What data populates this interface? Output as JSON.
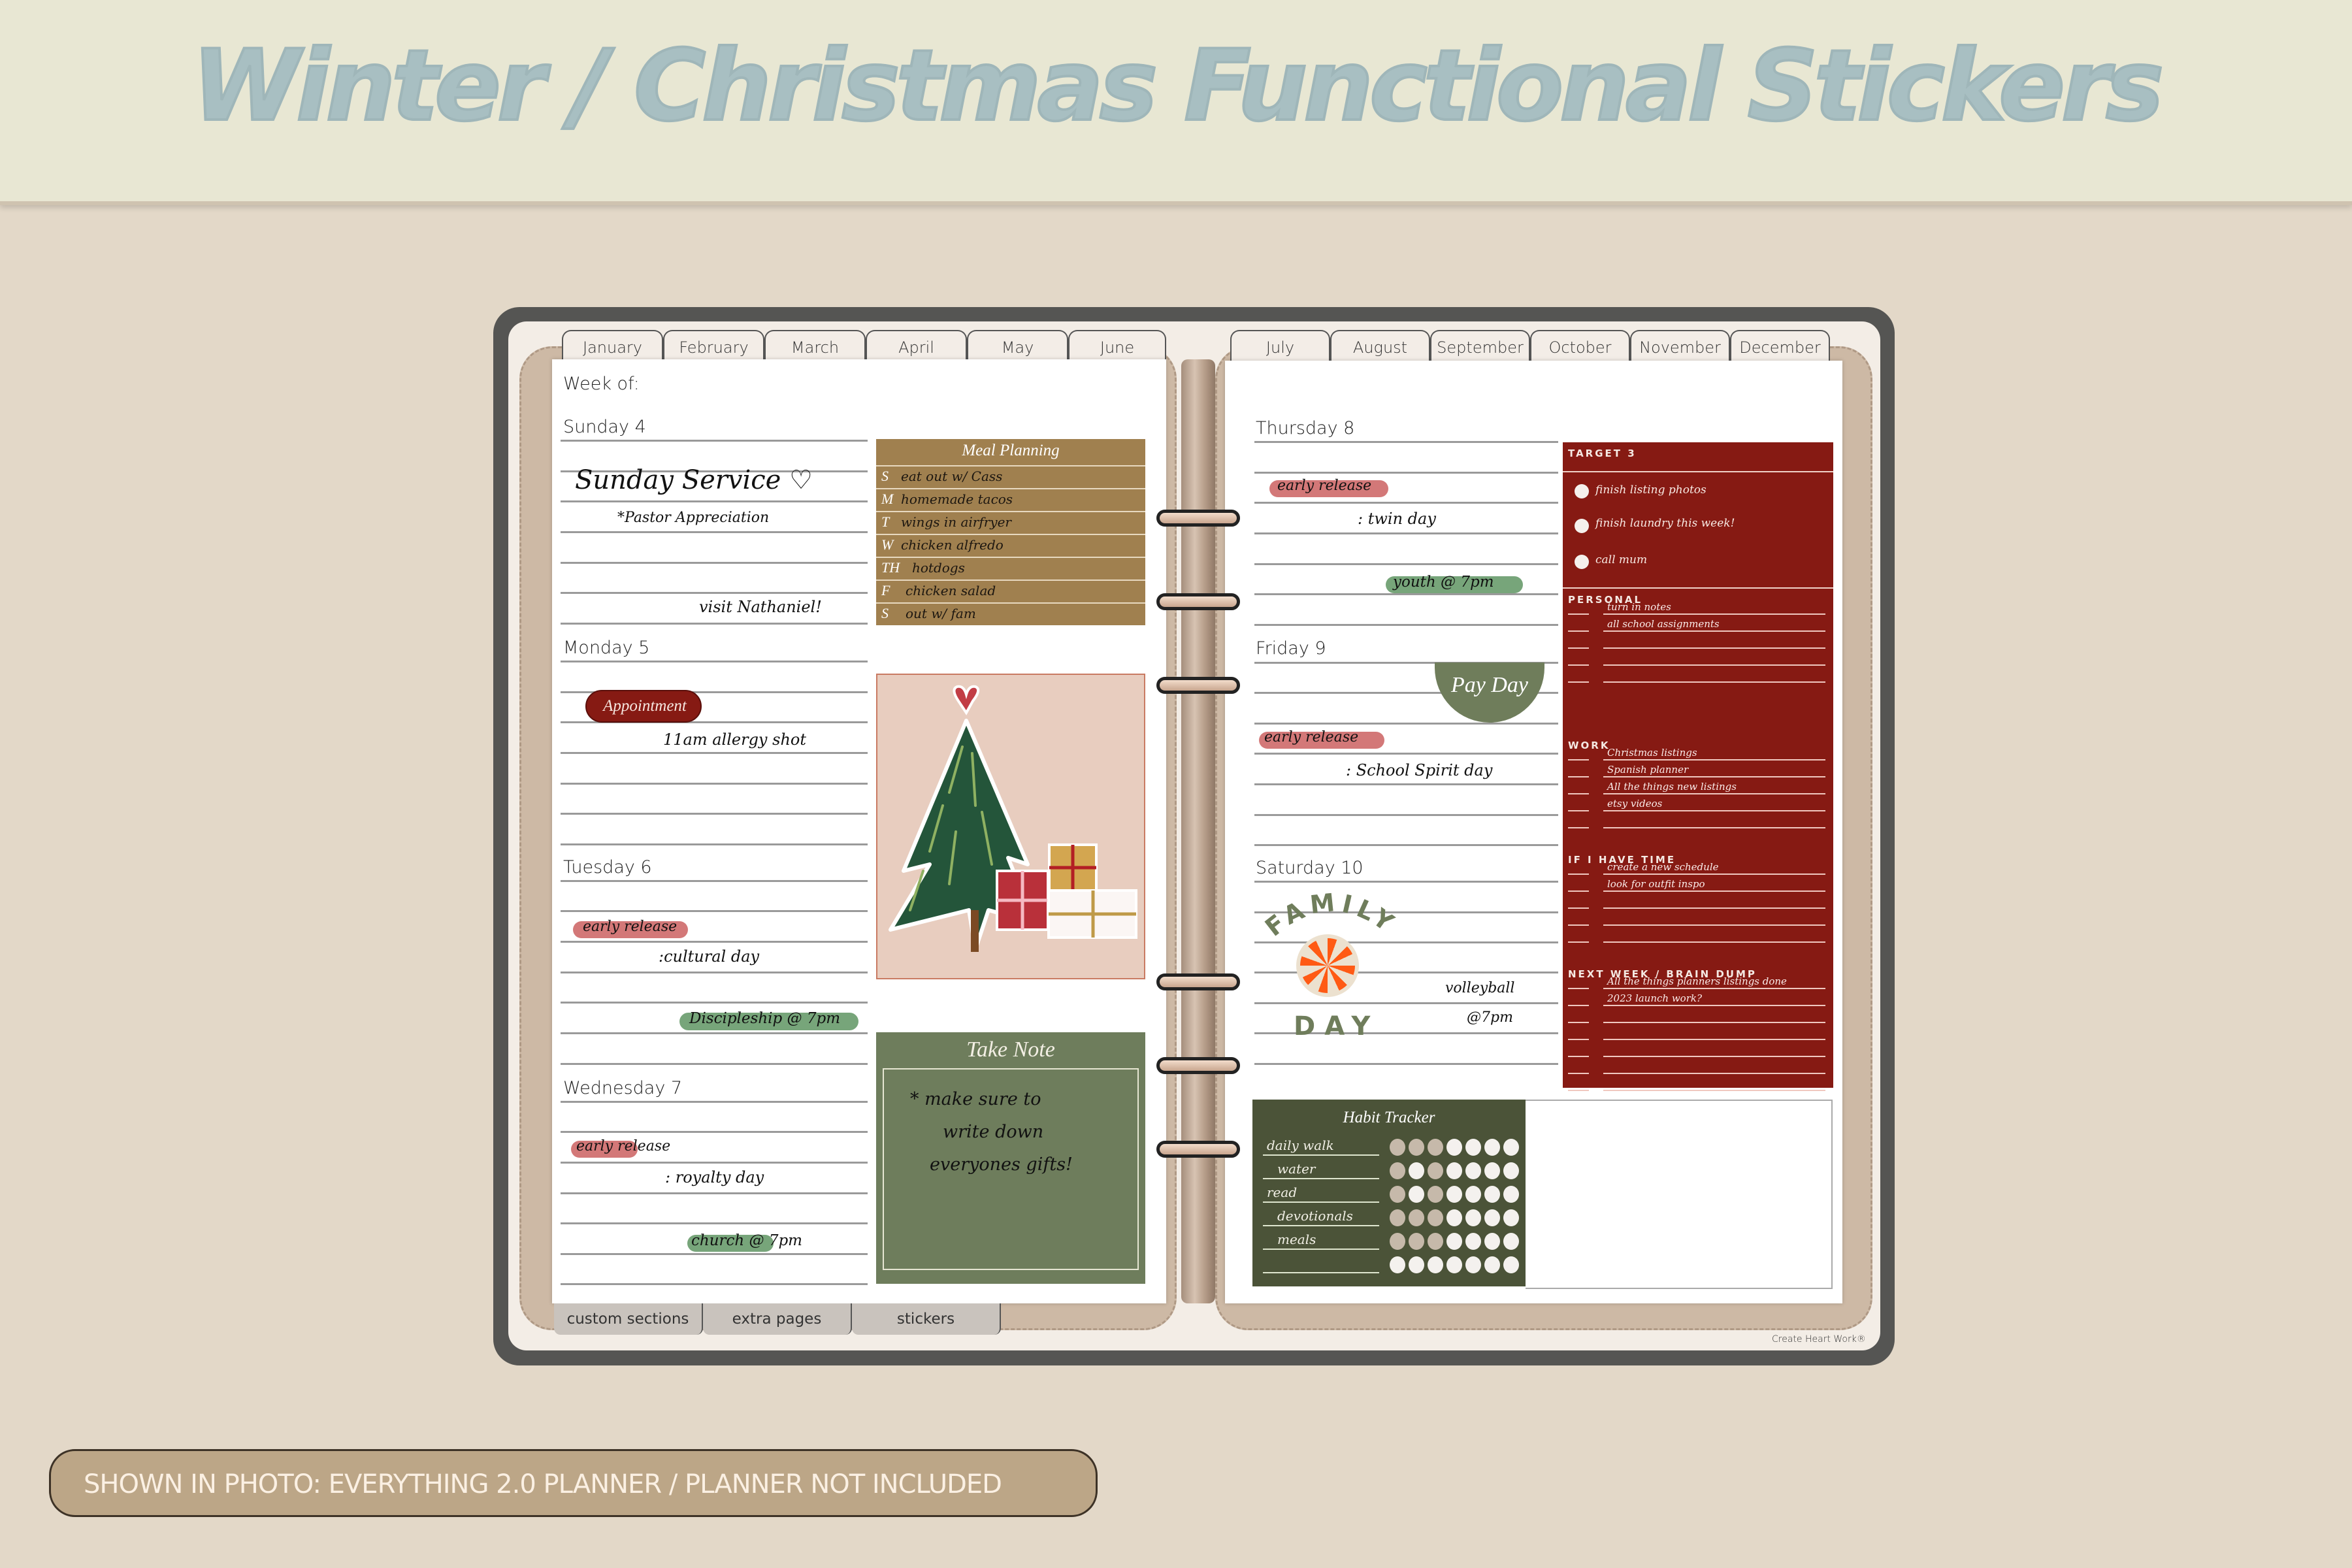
{
  "banner": {
    "title": "Winter / Christmas Functional Stickers"
  },
  "planner": {
    "month_tabs_left": [
      "January",
      "February",
      "March",
      "April",
      "May",
      "June"
    ],
    "month_tabs_right": [
      "July",
      "August",
      "September",
      "October",
      "November",
      "December"
    ],
    "bottom_tabs": [
      "custom sections",
      "extra pages",
      "stickers"
    ],
    "brand": "Create Heart Work®",
    "week_of_label": "Week of:",
    "days": {
      "sunday": {
        "label": "Sunday 4",
        "notes": [
          "Sunday Service ♡",
          "*Pastor Appreciation",
          "visit Nathaniel!"
        ]
      },
      "monday": {
        "label": "Monday 5",
        "sticker": "Appointment",
        "notes": [
          "11am allergy shot"
        ]
      },
      "tuesday": {
        "label": "Tuesday 6",
        "highlight_red": "early release",
        "notes": [
          ":cultural day"
        ],
        "highlight_green": "Discipleship @ 7pm"
      },
      "wednesday": {
        "label": "Wednesday 7",
        "highlight_red": "early release",
        "notes": [
          ": royalty day"
        ],
        "highlight_green": "church @ 7pm"
      },
      "thursday": {
        "label": "Thursday 8",
        "highlight_red": "early release",
        "notes": [
          ": twin day"
        ],
        "highlight_green": "youth @ 7pm"
      },
      "friday": {
        "label": "Friday 9",
        "sticker": "Pay Day",
        "highlight_red": "early release",
        "notes": [
          ": School Spirit day"
        ]
      },
      "saturday": {
        "label": "Saturday 10",
        "sticker_top": "FAMILY",
        "sticker_bottom": "DAY",
        "notes": [
          "volleyball",
          "@7pm"
        ]
      }
    },
    "meal_planning": {
      "title": "Meal Planning",
      "rows": [
        {
          "day": "S",
          "meal": "eat out w/ Cass"
        },
        {
          "day": "M",
          "meal": "homemade tacos"
        },
        {
          "day": "T",
          "meal": "wings in airfryer"
        },
        {
          "day": "W",
          "meal": "chicken alfredo"
        },
        {
          "day": "TH",
          "meal": "hotdogs"
        },
        {
          "day": "F",
          "meal": "chicken salad"
        },
        {
          "day": "S",
          "meal": "out w/ fam"
        }
      ]
    },
    "take_note": {
      "title": "Take Note",
      "lines": [
        "* make sure to",
        "write down",
        "everyones gifts!"
      ]
    },
    "target": {
      "title": "TARGET 3",
      "items": [
        "finish listing photos",
        "finish laundry this week!",
        "call mum"
      ],
      "sections": [
        {
          "title": "PERSONAL",
          "lines": [
            "turn in notes",
            "all school assignments",
            "",
            "",
            ""
          ]
        },
        {
          "title": "WORK",
          "lines": [
            "Christmas listings",
            "Spanish planner",
            "All the things new listings",
            "etsy videos",
            ""
          ]
        },
        {
          "title": "IF I HAVE TIME",
          "lines": [
            "create a new schedule",
            "look for outfit inspo",
            "",
            "",
            ""
          ]
        },
        {
          "title": "NEXT WEEK / BRAIN DUMP",
          "lines": [
            "All the things planners listings done",
            "2023 launch work?",
            "",
            "",
            "",
            "",
            ""
          ]
        }
      ]
    },
    "habit_tracker": {
      "title": "Habit Tracker",
      "habits": [
        {
          "name": "daily walk",
          "days": [
            1,
            1,
            1,
            0,
            0,
            0,
            0
          ]
        },
        {
          "name": "water",
          "days": [
            1,
            0,
            1,
            0,
            0,
            0,
            0
          ]
        },
        {
          "name": "read",
          "days": [
            1,
            0,
            1,
            0,
            0,
            0,
            0
          ]
        },
        {
          "name": "devotionals",
          "days": [
            1,
            1,
            1,
            0,
            0,
            0,
            0
          ]
        },
        {
          "name": "meals",
          "days": [
            1,
            1,
            1,
            0,
            0,
            0,
            0
          ]
        },
        {
          "name": "",
          "days": [
            0,
            0,
            0,
            0,
            0,
            0,
            0
          ]
        }
      ]
    }
  },
  "footer_note": "SHOWN IN PHOTO:  EVERYTHING 2.0 PLANNER / PLANNER NOT INCLUDED",
  "colors": {
    "header_bg": "#e8e7d3",
    "title": "#a8bfc2",
    "burgundy": "#861a13",
    "sage": "#6f7d5b",
    "mustard": "#a0804f",
    "pink_highlight": "#d37878",
    "green_highlight": "#77a57a"
  }
}
